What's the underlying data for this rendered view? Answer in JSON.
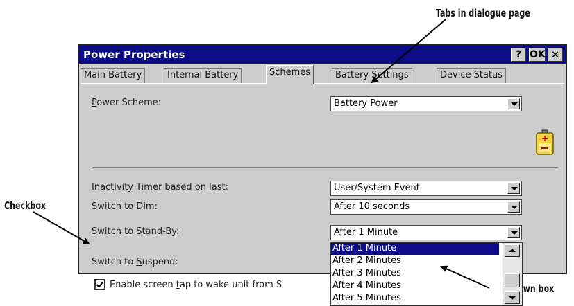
{
  "annotations": {
    "tabs_callout": "Tabs in dialogue page",
    "checkbox_callout": "Checkbox",
    "dropdown_callout": "Dropdown box"
  },
  "window": {
    "title": "Power Properties",
    "help_label": "?",
    "ok_label": "OK",
    "close_label": "×"
  },
  "tabs": [
    {
      "label": "Main Battery",
      "active": false
    },
    {
      "label": "Internal Battery",
      "active": false
    },
    {
      "label": "Schemes",
      "active": true
    },
    {
      "label": "Battery Settings",
      "active": false
    },
    {
      "label": "Device Status",
      "active": false
    }
  ],
  "form": {
    "power_scheme": {
      "label_pre": "",
      "label_key": "P",
      "label_post": "ower Scheme:",
      "value": "Battery Power"
    },
    "inactivity": {
      "label": "Inactivity Timer based on last:",
      "value": "User/System Event"
    },
    "dim": {
      "label_pre": "Switch to ",
      "label_key": "D",
      "label_post": "im:",
      "value": "After 10 seconds"
    },
    "standby": {
      "label_pre": "Switch to S",
      "label_key": "t",
      "label_post": "and-By:",
      "value": "After 1 Minute"
    },
    "suspend": {
      "label_pre": "Switch to ",
      "label_key": "S",
      "label_post": "uspend:"
    },
    "tap_wake": {
      "label_pre": "Enable screen ",
      "label_key": "t",
      "label_post": "ap to wake unit from S",
      "checked": true
    }
  },
  "dropdown_options": [
    "After 1 Minute",
    "After 2 Minutes",
    "After 3 Minutes",
    "After 4 Minutes",
    "After 5 Minutes"
  ],
  "dropdown_selected_index": 0,
  "colors": {
    "titlebar": "#0c0c86",
    "dialog_bg": "#cdcdcd",
    "selection": "#0c0c86",
    "battery": "#e8c700"
  },
  "icons": {
    "battery": "battery-icon",
    "checkmark": "checkmark-icon"
  }
}
